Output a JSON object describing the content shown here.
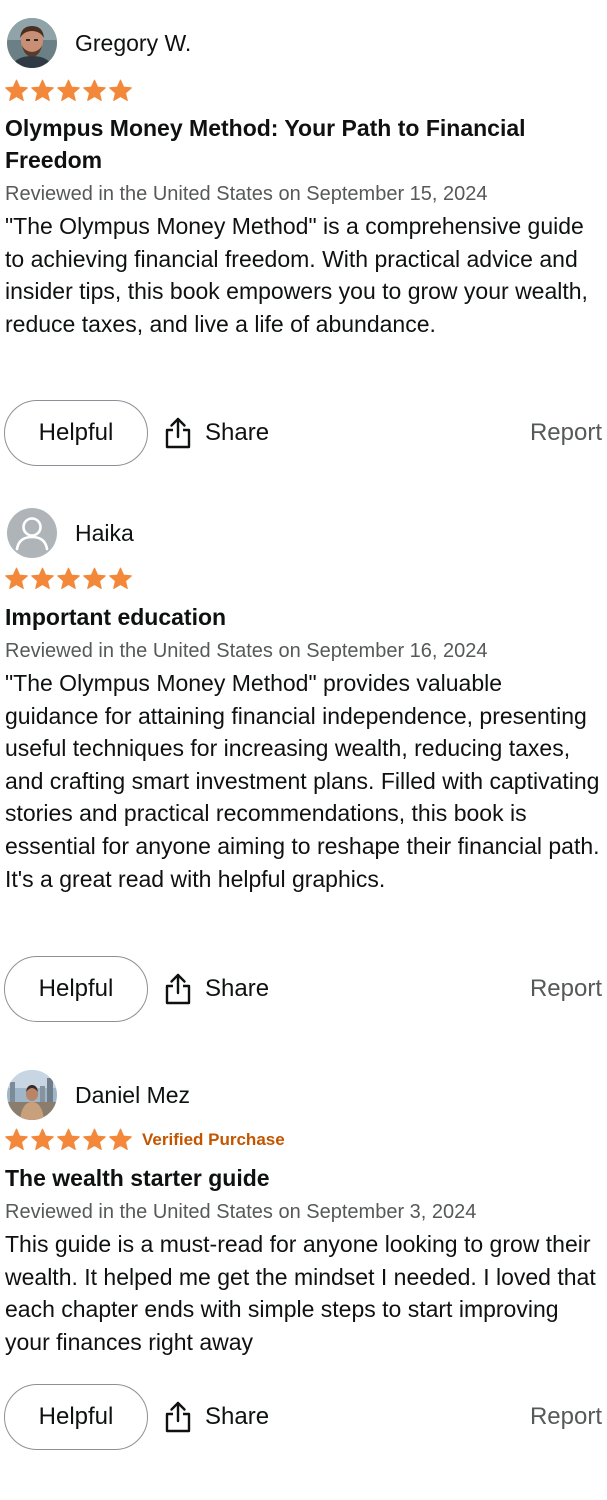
{
  "colors": {
    "star": "#f3883a",
    "verified": "#c45500",
    "meta_text": "#565959",
    "button_border": "#8d9096"
  },
  "reviews": [
    {
      "reviewer": "Gregory W.",
      "avatar": "photo-avatar",
      "rating": 5,
      "verified_label": "",
      "title": "Olympus Money Method: Your Path to Financial Freedom",
      "date": "Reviewed in the United States on September 15, 2024",
      "body": "\"The Olympus Money Method\" is a comprehensive guide to achieving financial freedom. With practical advice and insider tips, this book empowers you to grow your wealth, reduce taxes, and live a life of abundance.",
      "helpful_label": "Helpful",
      "share_label": "Share",
      "report_label": "Report"
    },
    {
      "reviewer": "Haika",
      "avatar": "default-user-icon",
      "rating": 5,
      "verified_label": "",
      "title": "Important education",
      "date": "Reviewed in the United States on September 16, 2024",
      "body": "\"The Olympus Money Method\" provides valuable guidance for attaining financial independence, presenting useful techniques for increasing wealth, reducing taxes, and crafting smart investment plans. Filled with captivating stories and practical recommendations, this book is essential for anyone aiming to reshape their financial path. It's a great read with helpful graphics.",
      "helpful_label": "Helpful",
      "share_label": "Share",
      "report_label": "Report"
    },
    {
      "reviewer": "Daniel Mez",
      "avatar": "photo-avatar",
      "rating": 5,
      "verified_label": "Verified Purchase",
      "title": "The wealth starter guide",
      "date": "Reviewed in the United States on September 3, 2024",
      "body": "This guide is a must-read for anyone looking to grow their wealth. It helped me get the mindset I needed. I loved that each chapter ends with simple steps to start improving your finances right away",
      "helpful_label": "Helpful",
      "share_label": "Share",
      "report_label": "Report"
    }
  ]
}
